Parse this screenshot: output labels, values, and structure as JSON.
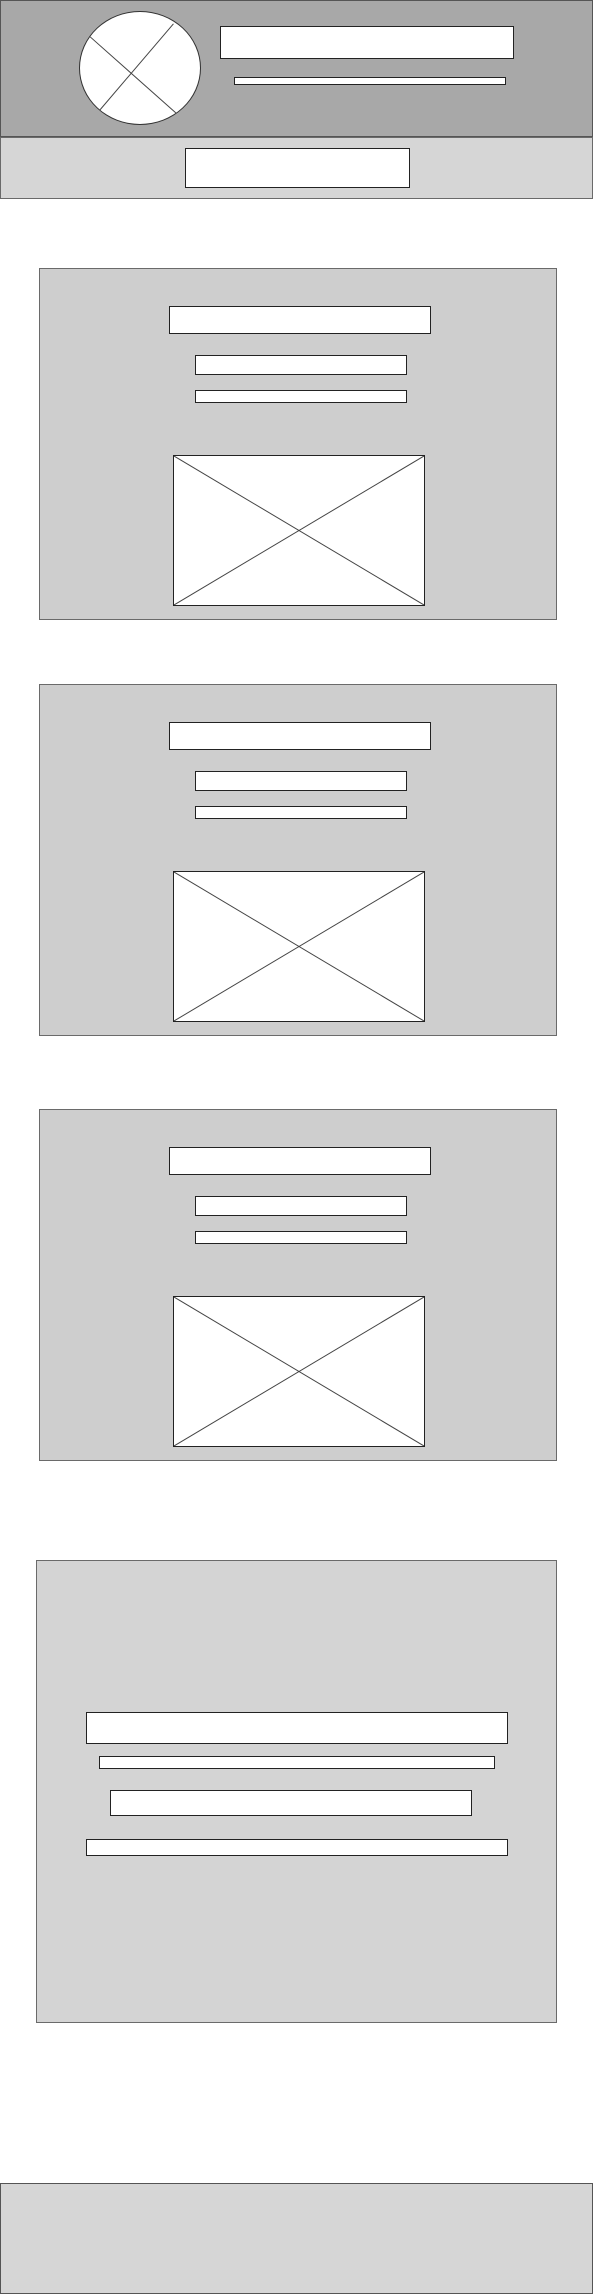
{
  "header": {
    "title": "",
    "subtitle": "",
    "logo_icon": "logo-placeholder-icon"
  },
  "nav": {
    "label": ""
  },
  "cards": [
    {
      "title": "",
      "line1": "",
      "line2": "",
      "image_icon": "image-placeholder-icon"
    },
    {
      "title": "",
      "line1": "",
      "line2": "",
      "image_icon": "image-placeholder-icon"
    },
    {
      "title": "",
      "line1": "",
      "line2": "",
      "image_icon": "image-placeholder-icon"
    }
  ],
  "contact": {
    "line1": "",
    "line2": "",
    "line3": "",
    "line4": ""
  },
  "footer": {
    "text": ""
  },
  "colors": {
    "header_bg": "#a8a8a8",
    "panel_bg": "#d0d0d0",
    "card_bg": "#cecece",
    "placeholder_fill": "#ffffff"
  }
}
